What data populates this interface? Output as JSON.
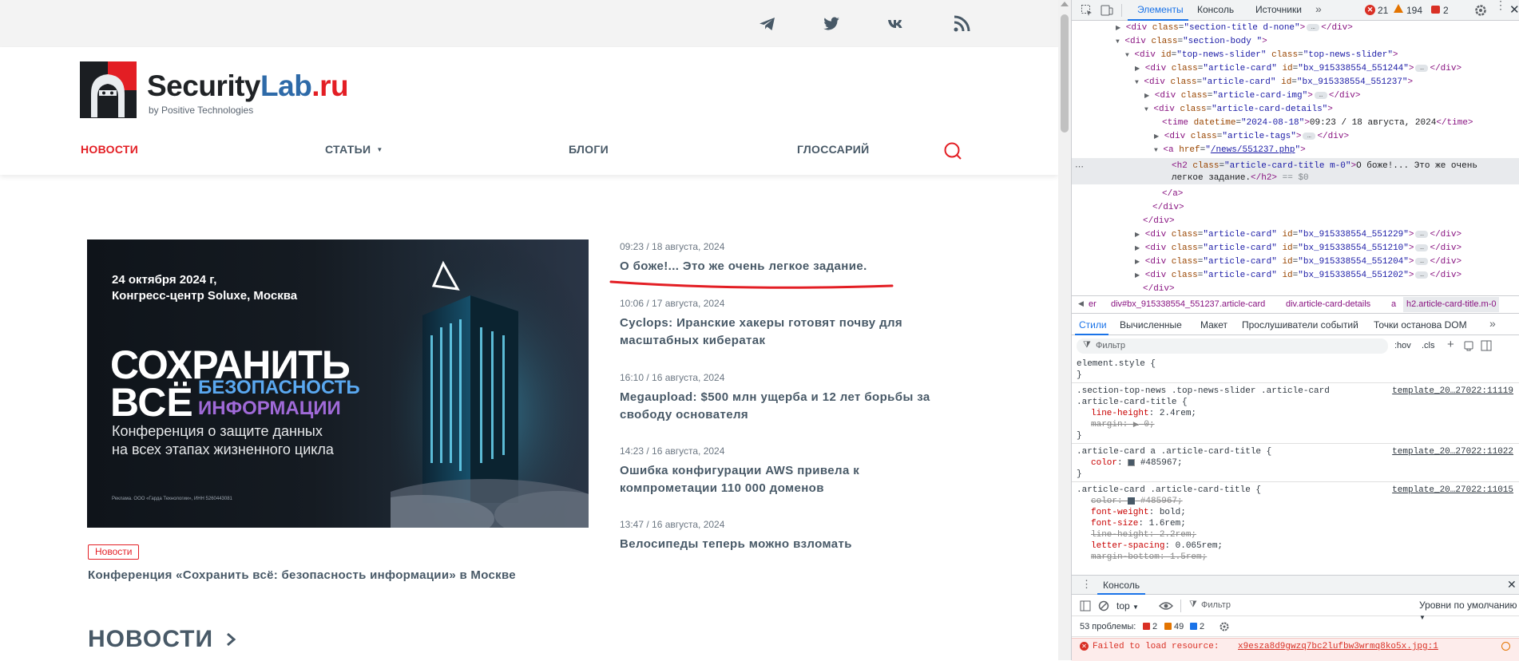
{
  "site": {
    "logo": {
      "brand_main": "Security",
      "brand_lab": "Lab",
      "brand_tld": ".ru",
      "tagline": "by Positive Technologies"
    },
    "social_icons": [
      "telegram-icon",
      "twitter-icon",
      "vk-icon",
      "rss-icon"
    ],
    "nav": [
      {
        "label": "НОВОСТИ",
        "active": true
      },
      {
        "label": "СТАТЬИ",
        "has_dropdown": true
      },
      {
        "label": "БЛОГИ"
      },
      {
        "label": "ГЛОССАРИЙ"
      }
    ],
    "accent_color": "#e31e24",
    "text_color": "#485967",
    "promo": {
      "date_line1": "24 октября 2024 г,",
      "date_line2": "Конгресс-центр Soluxe, Москва",
      "headline1": "СОХРАНИТЬ",
      "headline2": "ВСЁ",
      "headline3a": "БЕЗОПАСНОСТЬ",
      "headline3b": "ИНФОРМАЦИИ",
      "sub1": "Конференция о защите данных",
      "sub2": "на всех этапах жизненного цикла",
      "ad_note": "Реклама. ООО «Гарда Технологии», ИНН 5260443081",
      "tag": "Новости",
      "caption": "Конференция «Сохранить всё: безопасность информации» в Москве"
    },
    "news": [
      {
        "time": "09:23 / 18 августа, 2024",
        "title": "О боже!... Это же очень легкое задание."
      },
      {
        "time": "10:06 / 17 августа, 2024",
        "title": "Cyclops: Иранские хакеры готовят почву для масштабных кибератак"
      },
      {
        "time": "16:10 / 16 августа, 2024",
        "title": "Megaupload: $500 млн ущерба и 12 лет борьбы за свободу основателя"
      },
      {
        "time": "14:23 / 16 августа, 2024",
        "title": "Ошибка конфигурации AWS привела к компрометации 110 000 доменов"
      },
      {
        "time": "13:47 / 16 августа, 2024",
        "title": "Велосипеды теперь можно взломать"
      }
    ],
    "section_heading": "НОВОСТИ"
  },
  "devtools": {
    "tabs": [
      "Элементы",
      "Консоль",
      "Источники"
    ],
    "counts": {
      "errors": "21",
      "warnings": "194",
      "issues": "2"
    },
    "dom": {
      "l1_attr": "class",
      "l1_val": "\"section-title d-none\"",
      "l2_val": "\"section-body \"",
      "l3_id": "\"top-news-slider\"",
      "l3_class": "\"top-news-slider\"",
      "card_class": "\"article-card\"",
      "card1_id": "\"bx_915338554_551244\"",
      "card2_id": "\"bx_915338554_551237\"",
      "img_class": "\"article-card-img\"",
      "details_class": "\"article-card-details\"",
      "time_datetime": "\"2024-08-18\"",
      "time_text": "09:23 / 18 августа, 2024",
      "tags_class": "\"article-tags\"",
      "href": "/news/551237.php",
      "h2_class": "\"article-card-title m-0\"",
      "h2_text1": "О боже!... Это же очень",
      "h2_text2": "легкое задание.",
      "selected_marker": "== $0",
      "card3_id": "\"bx_915338554_551229\"",
      "card4_id": "\"bx_915338554_551210\"",
      "card5_id": "\"bx_915338554_551204\"",
      "card6_id": "\"bx_915338554_551202\""
    },
    "breadcrumb": [
      "er",
      "div#bx_915338554_551237.article-card",
      "div.article-card-details",
      "a",
      "h2.article-card-title.m-0"
    ],
    "style_tabs": [
      "Стили",
      "Вычисленные",
      "Макет",
      "Прослушиватели событий",
      "Точки останова DOM"
    ],
    "filter_placeholder": "Фильтр",
    "hov": ":hov",
    "cls": ".cls",
    "css": {
      "element_style": "element.style {",
      "rule1_sel1": ".section-top-news .top-news-slider .article-card",
      "rule1_sel2": ".article-card-title {",
      "rule1_src": "template_20…27022:11119",
      "rule1_p1": "line-height",
      "rule1_v1": "2.4rem;",
      "rule1_p2": "margin",
      "rule1_v2": "0;",
      "rule2_sel": ".article-card a .article-card-title {",
      "rule2_src": "template_20…27022:11022",
      "rule2_p1": "color",
      "rule2_v1": "#485967;",
      "rule3_sel": ".article-card .article-card-title {",
      "rule3_src": "template_20…27022:11015",
      "rule3_p1": "color",
      "rule3_v1": "#485967;",
      "rule3_p2": "font-weight",
      "rule3_v2": "bold;",
      "rule3_p3": "font-size",
      "rule3_v3": "1.6rem;",
      "rule3_p4": "line-height",
      "rule3_v4": "2.2rem;",
      "rule3_p5": "letter-spacing",
      "rule3_v5": "0.065rem;",
      "rule3_p6": "margin-bottom",
      "rule3_v6": "1.5rem;",
      "close_brace": "}"
    },
    "console": {
      "tab": "Консоль",
      "context": "top",
      "filter_placeholder": "Фильтр",
      "levels": "Уровни по умолчанию",
      "problems_label": "53 проблемы:",
      "p_err": "2",
      "p_warn": "49",
      "p_info": "2",
      "error_msg": "Failed to load resource:",
      "error_src": "x9esza8d9gwzq7bc2lufbw3wrmq8ko5x.jpg:1"
    }
  }
}
